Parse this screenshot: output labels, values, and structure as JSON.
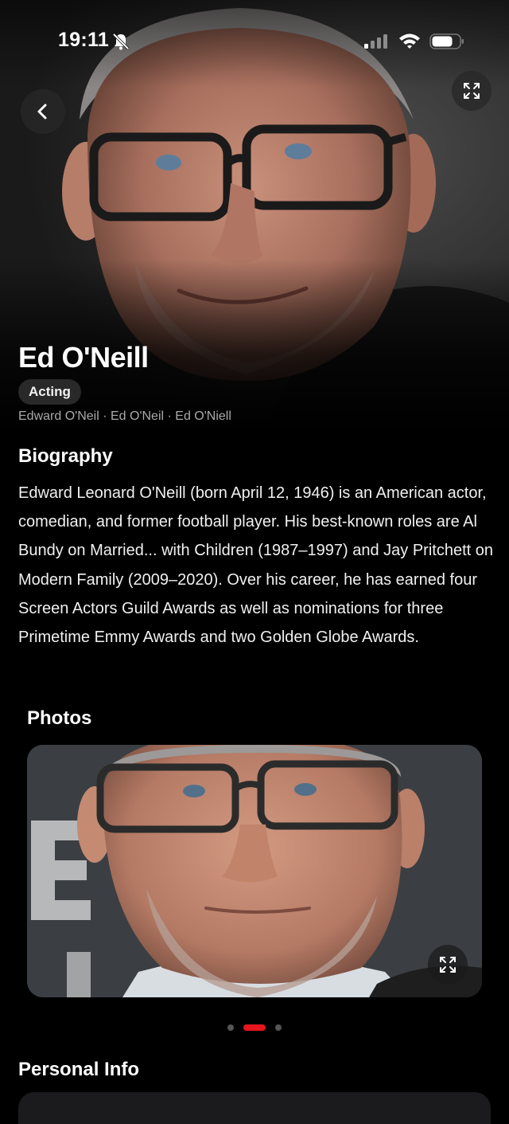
{
  "status_bar": {
    "time": "19:11",
    "icons": [
      "bell-slash-icon",
      "cellular-signal-icon",
      "wifi-icon",
      "battery-icon"
    ]
  },
  "navigation": {
    "back_icon": "chevron-left-icon",
    "expand_icon": "expand-arrows-icon"
  },
  "person": {
    "name": "Ed O'Neill",
    "department": "Acting",
    "also_known_as": "Edward O'Neil · Ed O'Neil · Ed O'Niell"
  },
  "biography": {
    "title": "Biography",
    "text": "Edward Leonard O'Neill (born April 12, 1946) is an American actor, comedian, and former football player. His best-known roles are Al Bundy on Married... with Children (1987–1997) and Jay Pritchett on Modern Family (2009–2020). Over his career, he has earned four Screen Actors Guild Awards as well as nominations for three Primetime Emmy Awards and two Golden Globe Awards."
  },
  "photos": {
    "title": "Photos",
    "expand_icon": "expand-arrows-icon",
    "page_count": 3,
    "active_page": 2
  },
  "personal_info": {
    "title": "Personal Info"
  },
  "colors": {
    "background": "#000000",
    "accent": "#e5161e",
    "chip_bg": "#2d2d2d",
    "muted_text": "#a9a9a9"
  }
}
